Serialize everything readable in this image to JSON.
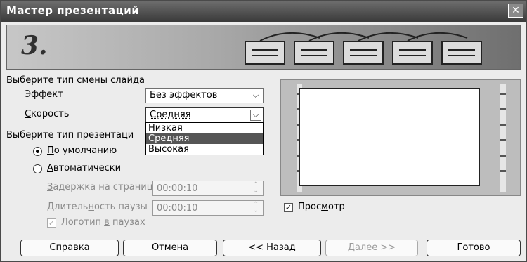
{
  "window": {
    "title": "Мастер презентаций",
    "close_glyph": "✕"
  },
  "banner": {
    "step_number": "3."
  },
  "transition": {
    "group_label": "Выберите тип смены слайда",
    "effect_label": "Эффект",
    "effect_value": "Без эффектов",
    "speed_label": "Скорость",
    "speed_value": "Средняя",
    "speed_options": [
      "Низкая",
      "Средняя",
      "Высокая"
    ]
  },
  "presentation": {
    "group_label": "Выберите тип презентаци",
    "default_label": "По умолчанию",
    "auto_label": "Автоматически",
    "delay_label": "Задержка на страниц",
    "delay_value": "00:00:10",
    "pause_label": "Длительность паузы",
    "pause_value": "00:00:10",
    "logo_label": "Логотип в паузах"
  },
  "preview_checkbox_label": "Просмотр",
  "buttons": {
    "help": "Справка",
    "cancel": "Отмена",
    "back": "<< Назад",
    "next": "Далее >>",
    "finish": "Готово"
  }
}
